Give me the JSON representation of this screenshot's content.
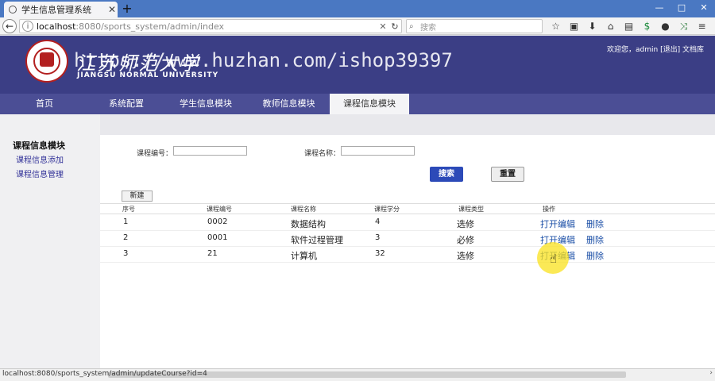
{
  "browser": {
    "tab_title": "学生信息管理系统",
    "tab_close": "✕",
    "new_tab": "+",
    "url_host": "localhost",
    "url_path": ":8080/sports_system/admin/index",
    "search_placeholder": "搜索",
    "status_url": "localhost:8080/sports_system/admin/updateCourse?id=4",
    "window_controls": [
      "—",
      "□",
      "✕"
    ],
    "toolbar_icons": [
      "star-icon",
      "clipboard-icon",
      "download-icon",
      "home-icon",
      "reader-icon",
      "extension-icon",
      "chat-icon",
      "share-icon",
      "menu-icon"
    ]
  },
  "header": {
    "logo_cn": "江苏师范大学",
    "logo_en": "JIANGSU NORMAL UNIVERSITY",
    "watermark": "https://www.huzhan.com/ishop39397",
    "user_info": "欢迎您，admin [退出]  文档库"
  },
  "nav": {
    "items": [
      {
        "label": "首页",
        "active": false
      },
      {
        "label": "系统配置",
        "active": false
      },
      {
        "label": "学生信息模块",
        "active": false
      },
      {
        "label": "教师信息模块",
        "active": false
      },
      {
        "label": "课程信息模块",
        "active": true
      }
    ]
  },
  "sidebar": {
    "title": "课程信息模块",
    "links": [
      "课程信息添加",
      "课程信息管理"
    ]
  },
  "search": {
    "code_label": "课程编号：",
    "name_label": "课程名称：",
    "code_value": "",
    "name_value": "",
    "search_button": "搜索",
    "reset_button": "重置",
    "new_button": "新建"
  },
  "table": {
    "headers": [
      "序号",
      "课程编号",
      "课程名称",
      "课程学分",
      "课程类型",
      "操作"
    ],
    "rows": [
      {
        "index": "1",
        "code": "0002",
        "name": "数据结构",
        "credit": "4",
        "type": "选修",
        "edit": "打开编辑",
        "delete": "删除"
      },
      {
        "index": "2",
        "code": "0001",
        "name": "软件过程管理",
        "credit": "3",
        "type": "必修",
        "edit": "打开编辑",
        "delete": "删除"
      },
      {
        "index": "3",
        "code": "21",
        "name": "计算机",
        "credit": "32",
        "type": "选修",
        "edit": "打开编辑",
        "delete": "删除"
      }
    ]
  },
  "colors": {
    "header_bg": "#3b3e85",
    "nav_bg": "#4b4e95",
    "link": "#1a4ea6",
    "primary_button": "#2c4ab8",
    "browser_tabbar": "#4a78c2"
  }
}
